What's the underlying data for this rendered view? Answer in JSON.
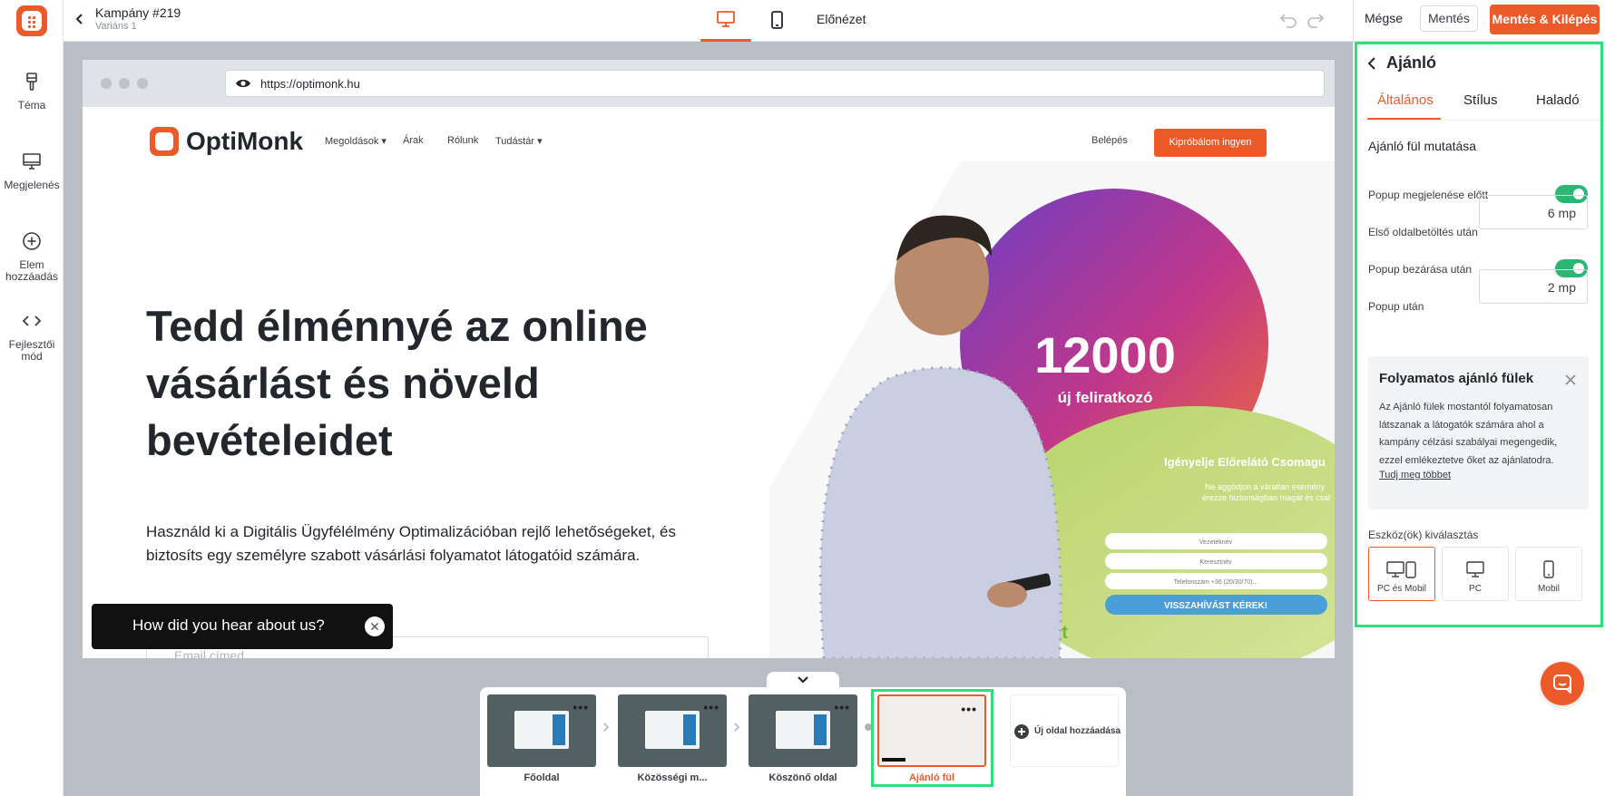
{
  "sidebar": {
    "items": [
      {
        "label": "Téma",
        "icon": "paint-brush-icon"
      },
      {
        "label": "Megjelenés",
        "icon": "monitor-icon"
      },
      {
        "label": "Elem hozzáadás",
        "icon": "plus-circle-icon"
      },
      {
        "label": "Fejlesztői mód",
        "icon": "code-icon"
      }
    ]
  },
  "topbar": {
    "campaign_title": "Kampány #219",
    "campaign_subtitle": "Variáns 1",
    "preview_label": "Előnézet",
    "cancel_label": "Mégse",
    "save_label": "Mentés",
    "save_exit_label": "Mentés & Kilépés"
  },
  "browser": {
    "url": "https://optimonk.hu"
  },
  "site": {
    "logo_text": "OptiMonk",
    "nav": [
      "Megoldások",
      "Árak",
      "Rólunk",
      "Tudástár"
    ],
    "login_label": "Belépés",
    "cta_label": "Kipróbálom ingyen",
    "hero_title": "Tedd élménnyé az online vásárlást és növeld bevételeidet",
    "hero_text": "Használd ki a Digitális Ügyfélélmény Optimalizációban rejlő lehetőségeket, és biztosíts egy személyre szabott vásárlási folyamatot látogatóid számára.",
    "email_placeholder": "Email címed",
    "promo_number": "12000",
    "promo_caption": "új feliratkozó",
    "form_title": "Igényelje Előrelátó Csomagu",
    "form_sub1": "Ne aggódjon a váratlan esemény",
    "form_sub2": "érezze biztonságban magát és csal",
    "form_field1": "Vezetéknév",
    "form_field2": "Keresztnév",
    "form_field3": "Telefonszám +36 (20/30/70)...",
    "form_button": "VISSZAHÍVÁST KÉREK!",
    "form_brand": "vident"
  },
  "teaser": {
    "text": "How did you hear about us?"
  },
  "pages": [
    {
      "label": "Főoldal",
      "active": false
    },
    {
      "label": "Közösségi m...",
      "active": false
    },
    {
      "label": "Köszönő oldal",
      "active": false
    },
    {
      "label": "Ajánló fül",
      "active": true
    }
  ],
  "add_page_label": "Új oldal hozzáadása",
  "panel": {
    "title": "Ajánló",
    "tabs": [
      "Általános",
      "Stílus",
      "Haladó"
    ],
    "section_title": "Ajánló fül mutatása",
    "rows": {
      "before_popup": "Popup megjelenése előtt",
      "after_first_load": "Első oldalbetöltés után",
      "after_first_load_value": "6 mp",
      "after_close": "Popup bezárása után",
      "after_popup": "Popup után",
      "after_popup_value": "2 mp"
    },
    "toggles": {
      "before_popup": true,
      "after_close": true
    },
    "info": {
      "title": "Folyamatos ajánló fülek",
      "text": "Az Ajánló fülek mostantól folyamatosan látszanak a látogatók számára ahol a kampány célzási szabályai megengedik, ezzel emlékeztetve őket az ajánlatodra.",
      "link": "Tudj meg többet"
    },
    "device_label": "Eszköz(ök) kiválasztás",
    "devices": [
      {
        "label": "PC és Mobil",
        "selected": true
      },
      {
        "label": "PC",
        "selected": false
      },
      {
        "label": "Mobil",
        "selected": false
      }
    ]
  },
  "colors": {
    "accent": "#ed5a29",
    "toggle_on": "#2bb673",
    "highlight": "#2ee07a"
  }
}
